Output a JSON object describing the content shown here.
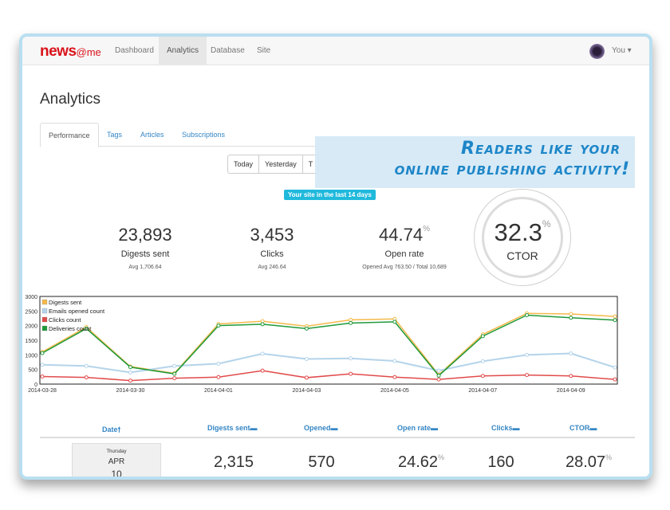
{
  "navbar": {
    "brand": "news",
    "brand_suffix": "@me",
    "links": [
      "Dashboard",
      "Analytics",
      "Database",
      "Site"
    ],
    "active": "Analytics",
    "user_label": "You ▾"
  },
  "page": {
    "title": "Analytics"
  },
  "tabs": [
    "Performance",
    "Tags",
    "Articles",
    "Subscriptions"
  ],
  "range_buttons": [
    "Today",
    "Yesterday",
    "T"
  ],
  "banner": {
    "line1": "Readers like your",
    "line2": "online publishing activity!"
  },
  "period_badge": "Your site in the last 14 days",
  "stats": [
    {
      "value": "23,893",
      "label": "Digests sent",
      "sub": "Avg 1,706.64"
    },
    {
      "value": "3,453",
      "label": "Clicks",
      "sub": "Avg 246.64"
    },
    {
      "value": "44.74",
      "suffix": "%",
      "label": "Open rate",
      "sub": "Opened Avg 763.50 / Total 10,689"
    }
  ],
  "ctor": {
    "value": "32.3",
    "suffix": "%",
    "label": "CTOR"
  },
  "chart_data": {
    "type": "line",
    "x": [
      "2014-03-28",
      "2014-03-29",
      "2014-03-30",
      "2014-03-31",
      "2014-04-01",
      "2014-04-02",
      "2014-04-03",
      "2014-04-04",
      "2014-04-05",
      "2014-04-06",
      "2014-04-07",
      "2014-04-08",
      "2014-04-09",
      "2014-04-10"
    ],
    "x_tick_labels": [
      "2014-03-28",
      "2014-03-30",
      "2014-04-01",
      "2014-04-03",
      "2014-04-05",
      "2014-04-07",
      "2014-04-09"
    ],
    "ylim": [
      0,
      3000
    ],
    "y_ticks": [
      "3000",
      "2500",
      "2000",
      "1500",
      "1000",
      "500",
      "0"
    ],
    "legend_position": "top-left",
    "series": [
      {
        "name": "Digests sent",
        "color": "#f5b94a",
        "values": [
          1100,
          1950,
          600,
          370,
          2060,
          2150,
          1980,
          2200,
          2230,
          320,
          1700,
          2420,
          2400,
          2315
        ]
      },
      {
        "name": "Emails opened count",
        "color": "#b4d4ea",
        "values": [
          660,
          620,
          400,
          620,
          700,
          1040,
          860,
          880,
          790,
          460,
          780,
          1000,
          1050,
          570
        ]
      },
      {
        "name": "Clicks count",
        "color": "#e14b4b",
        "values": [
          260,
          230,
          120,
          200,
          240,
          460,
          220,
          350,
          240,
          160,
          280,
          310,
          280,
          160
        ]
      },
      {
        "name": "Deliveries count",
        "color": "#1f9a3a",
        "values": [
          1060,
          1900,
          580,
          350,
          2000,
          2050,
          1900,
          2090,
          2130,
          290,
          1640,
          2360,
          2270,
          2190
        ]
      }
    ]
  },
  "table": {
    "headers": [
      "Date",
      "Digests sent",
      "Opened",
      "Open rate",
      "Clicks",
      "CTOR"
    ],
    "sort_icons": [
      "🠕",
      "▬",
      "▬",
      "▬",
      "▬",
      "▬"
    ],
    "first_row": {
      "weekday": "Thursday",
      "month": "APR",
      "day": "10",
      "digests_sent": "2,315",
      "opened": "570",
      "open_rate": "24.62",
      "clicks": "160",
      "ctor": "28.07",
      "pct": "%"
    }
  }
}
